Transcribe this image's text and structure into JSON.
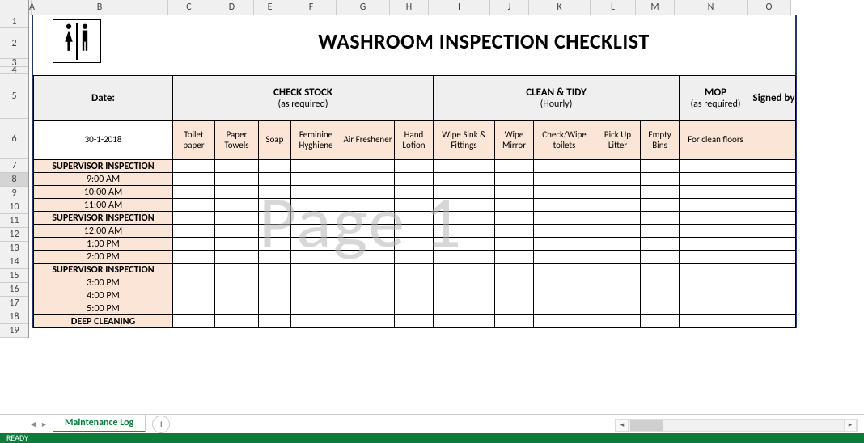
{
  "title": "WASHROOM INSPECTION CHECKLIST",
  "columns": [
    "A",
    "B",
    "C",
    "D",
    "E",
    "F",
    "G",
    "H",
    "I",
    "J",
    "K",
    "L",
    "M",
    "N",
    "O"
  ],
  "row_numbers": [
    "1",
    "2",
    "3",
    "4",
    "5",
    "6",
    "7",
    "8",
    "9",
    "10",
    "11",
    "12",
    "13",
    "14",
    "15",
    "16",
    "17",
    "18",
    "19"
  ],
  "selected_row": "8",
  "date_label": "Date:",
  "date_value": "30-1-2018",
  "groups": {
    "check_stock": {
      "title": "CHECK STOCK",
      "sub": "(as required)"
    },
    "clean_tidy": {
      "title": "CLEAN & TIDY",
      "sub": "(Hourly)"
    },
    "mop": {
      "title": "MOP",
      "sub": "(as required)"
    },
    "signed": {
      "title": "Signed by"
    }
  },
  "subheaders": {
    "toilet_paper": "Toilet paper",
    "paper_towels": "Paper Towels",
    "soap": "Soap",
    "feminine_hygiene": "Feminine Hyghiene",
    "air_freshener": "Air Freshener",
    "hand_lotion": "Hand Lotion",
    "wipe_sink": "Wipe Sink & Fittings",
    "wipe_mirror": "Wipe Mirror",
    "check_toilets": "Check/Wipe toilets",
    "pickup_litter": "Pick Up Litter",
    "empty_bins": "Empty Bins",
    "for_clean_floors": "For clean floors"
  },
  "rows": [
    {
      "type": "sup",
      "label": "SUPERVISOR INSPECTION"
    },
    {
      "type": "time",
      "label": "9:00 AM"
    },
    {
      "type": "time",
      "label": "10:00 AM"
    },
    {
      "type": "time",
      "label": "11:00 AM"
    },
    {
      "type": "sup",
      "label": "SUPERVISOR INSPECTION"
    },
    {
      "type": "time",
      "label": "12:00 AM"
    },
    {
      "type": "time",
      "label": "1:00 PM"
    },
    {
      "type": "time",
      "label": "2:00 PM"
    },
    {
      "type": "sup",
      "label": "SUPERVISOR INSPECTION"
    },
    {
      "type": "time",
      "label": "3:00 PM"
    },
    {
      "type": "time",
      "label": "4:00 PM"
    },
    {
      "type": "time",
      "label": "5:00 PM"
    },
    {
      "type": "sup",
      "label": "DEEP CLEANING"
    }
  ],
  "watermark": "Page 1",
  "sheet_tab": "Maintenance Log",
  "status": "READY",
  "add_sheet": "+"
}
